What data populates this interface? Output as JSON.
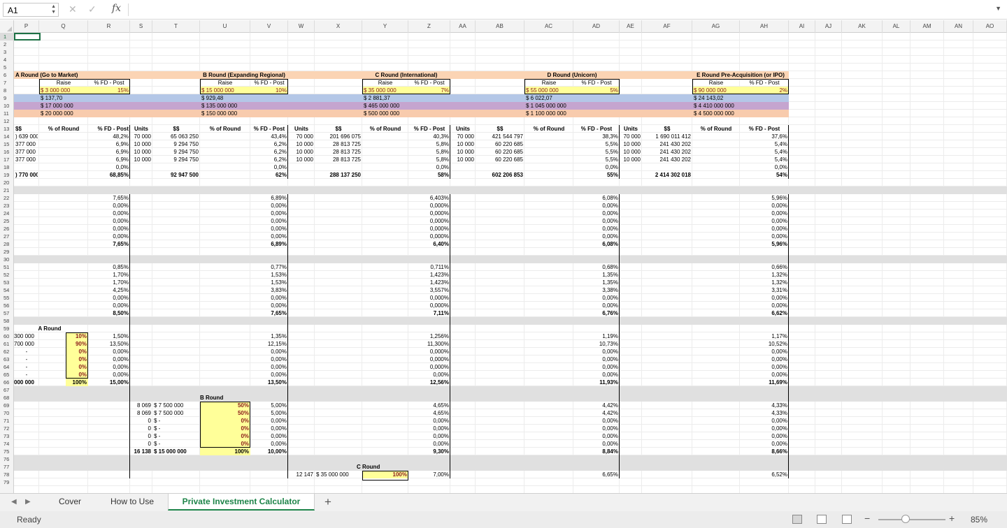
{
  "formula_bar": {
    "name_box": "A1",
    "fx": "fx",
    "formula": ""
  },
  "columns": [
    "P",
    "Q",
    "R",
    "S",
    "T",
    "U",
    "V",
    "W",
    "X",
    "Y",
    "Z",
    "AA",
    "AB",
    "AC",
    "AD",
    "AE",
    "AF",
    "AG",
    "AH",
    "AI",
    "AJ",
    "AK",
    "AL",
    "AM",
    "AN",
    "AO"
  ],
  "rows": [
    "1",
    "2",
    "3",
    "4",
    "5",
    "6",
    "7",
    "8",
    "9",
    "10",
    "11",
    "12",
    "13",
    "14",
    "15",
    "16",
    "17",
    "18",
    "19",
    "20",
    "21",
    "22",
    "23",
    "24",
    "25",
    "26",
    "27",
    "28",
    "29",
    "30",
    "51",
    "52",
    "53",
    "54",
    "55",
    "56",
    "57",
    "58",
    "59",
    "60",
    "61",
    "62",
    "63",
    "64",
    "65",
    "66",
    "67",
    "68",
    "69",
    "70",
    "71",
    "72",
    "73",
    "74",
    "75",
    "76",
    "77",
    "78",
    "79"
  ],
  "rounds": [
    {
      "title": "A Round (Go to Market)",
      "raise_hdr": "Raise",
      "fd_hdr": "% FD - Post",
      "raise": "$  3 000 000",
      "fd": "15%",
      "pps": "$        137,70",
      "pre": "$ 17 000 000",
      "post": "$ 20 000 000"
    },
    {
      "title": "B Round (Expanding Regional)",
      "raise_hdr": "Raise",
      "fd_hdr": "% FD - Post",
      "raise": "$  15 000 000",
      "fd": "10%",
      "pps": "$              929,48",
      "pre": "$ 135 000 000",
      "post": "$ 150 000 000"
    },
    {
      "title": "C Round (International)",
      "raise_hdr": "Raise",
      "fd_hdr": "% FD - Post",
      "raise": "$  35 000 000",
      "fd": "7%",
      "pps": "$      2 881,37",
      "pre": "$ 465 000 000",
      "post": "$ 500 000 000"
    },
    {
      "title": "D Round (Unicorn)",
      "raise_hdr": "Raise",
      "fd_hdr": "% FD - Post",
      "raise": "$     55 000 000",
      "fd": "5%",
      "pps": "$        6 022,07",
      "pre": "$ 1 045 000 000",
      "post": "$ 1 100 000 000"
    },
    {
      "title": "E Round Pre-Acquisition (or IPO)",
      "raise_hdr": "Raise",
      "fd_hdr": "% FD - Post",
      "raise": "$     90 000 000",
      "fd": "2%",
      "pps": "$       24 143,02",
      "pre": "$ 4 410 000 000",
      "post": "$ 4 500 000 000"
    }
  ],
  "table_hdr": {
    "units": "Units",
    "dollars": "$$",
    "pct_round": "% of Round",
    "fd_post": "% FD - Post"
  },
  "q_col": {
    "r13": "$$",
    "r14": ") 639 000",
    "r15": "377 000",
    "r16": "377 000",
    "r17": "377 000",
    "r19": ") 770 000"
  },
  "r_col": {
    "r14": "48,2%",
    "r15": "6,9%",
    "r16": "6,9%",
    "r17": "6,9%",
    "r18": "0,0%",
    "r19": "68,85%"
  },
  "s_col": {
    "r14": "70 000",
    "r15": "10 000",
    "r16": "10 000",
    "r17": "10 000"
  },
  "t_col": {
    "r14": "65 063 250",
    "r15": "9 294 750",
    "r16": "9 294 750",
    "r17": "9 294 750",
    "r19": "92 947 500"
  },
  "v_col": {
    "r14": "43,4%",
    "r15": "6,2%",
    "r16": "6,2%",
    "r17": "6,2%",
    "r18": "0,0%",
    "r19": "62%"
  },
  "w_col": {
    "r14": "70 000",
    "r15": "10 000",
    "r16": "10 000",
    "r17": "10 000"
  },
  "x_col": {
    "r14": "201 696 075",
    "r15": "28 813 725",
    "r16": "28 813 725",
    "r17": "28 813 725",
    "r19": "288 137 250"
  },
  "z_col": {
    "r14": "40,3%",
    "r15": "5,8%",
    "r16": "5,8%",
    "r17": "5,8%",
    "r18": "0,0%",
    "r19": "58%"
  },
  "aa_col": {
    "r14": "70 000",
    "r15": "10 000",
    "r16": "10 000",
    "r17": "10 000"
  },
  "ab_col": {
    "r14": "421 544 797",
    "r15": "60 220 685",
    "r16": "60 220 685",
    "r17": "60 220 685",
    "r19": "602 206 853"
  },
  "ad_col": {
    "r14": "38,3%",
    "r15": "5,5%",
    "r16": "5,5%",
    "r17": "5,5%",
    "r18": "0,0%",
    "r19": "55%"
  },
  "ae_col": {
    "r14": "70 000",
    "r15": "10 000",
    "r16": "10 000",
    "r17": "10 000"
  },
  "af_col": {
    "r14": "1 690 011 412",
    "r15": "241 430 202",
    "r16": "241 430 202",
    "r17": "241 430 202",
    "r19": "2 414 302 018"
  },
  "ah_col": {
    "r14": "37,6%",
    "r15": "5,4%",
    "r16": "5,4%",
    "r17": "5,4%",
    "r18": "0,0%",
    "r19": "54%"
  },
  "blk1": {
    "R": [
      "7,65%",
      "0,00%",
      "0,00%",
      "0,00%",
      "0,00%",
      "0,00%",
      "7,65%"
    ],
    "V": [
      "6,89%",
      "0,00%",
      "0,00%",
      "0,00%",
      "0,00%",
      "0,00%",
      "6,89%"
    ],
    "Z": [
      "6,403%",
      "0,000%",
      "0,000%",
      "0,000%",
      "0,000%",
      "0,000%",
      "6,40%"
    ],
    "AD": [
      "6,08%",
      "0,00%",
      "0,00%",
      "0,00%",
      "0,00%",
      "0,00%",
      "6,08%"
    ],
    "AH": [
      "5,96%",
      "0,00%",
      "0,00%",
      "0,00%",
      "0,00%",
      "0,00%",
      "5,96%"
    ]
  },
  "blk2": {
    "R": [
      "0,85%",
      "1,70%",
      "1,70%",
      "4,25%",
      "0,00%",
      "0,00%",
      "8,50%"
    ],
    "V": [
      "0,77%",
      "1,53%",
      "1,53%",
      "3,83%",
      "0,00%",
      "0,00%",
      "7,65%"
    ],
    "Z": [
      "0,711%",
      "1,423%",
      "1,423%",
      "3,557%",
      "0,000%",
      "0,000%",
      "7,11%"
    ],
    "AD": [
      "0,68%",
      "1,35%",
      "1,35%",
      "3,38%",
      "0,00%",
      "0,00%",
      "6,76%"
    ],
    "AH": [
      "0,66%",
      "1,32%",
      "1,32%",
      "3,31%",
      "0,00%",
      "0,00%",
      "6,62%"
    ]
  },
  "a_round": {
    "label": "A Round",
    "Q": [
      "300 000",
      "700 000",
      "-",
      "-",
      "-",
      "-"
    ],
    "Q_total": "000 000",
    "pct": [
      "10%",
      "90%",
      "0%",
      "0%",
      "0%",
      "0%"
    ],
    "pct_total": "100%",
    "R": [
      "1,50%",
      "13,50%",
      "0,00%",
      "0,00%",
      "0,00%",
      "0,00%",
      "15,00%"
    ],
    "V": [
      "1,35%",
      "12,15%",
      "0,00%",
      "0,00%",
      "0,00%",
      "0,00%",
      "13,50%"
    ],
    "Z": [
      "1,256%",
      "11,300%",
      "0,000%",
      "0,000%",
      "0,000%",
      "0,00%",
      "12,56%"
    ],
    "AD": [
      "1,19%",
      "10,73%",
      "0,00%",
      "0,00%",
      "0,00%",
      "0,00%",
      "11,93%"
    ],
    "AH": [
      "1,17%",
      "10,52%",
      "0,00%",
      "0,00%",
      "0,00%",
      "0,00%",
      "11,69%"
    ]
  },
  "b_round": {
    "label": "B Round",
    "S": [
      "8 069",
      "8 069",
      "0",
      "0",
      "0",
      "0"
    ],
    "S_total": "16 138",
    "T": [
      "$  7 500 000",
      "$  7 500 000",
      "$           -",
      "$           -",
      "$           -",
      "$           -"
    ],
    "T_total": "$ 15 000 000",
    "pct": [
      "50%",
      "50%",
      "0%",
      "0%",
      "0%",
      "0%"
    ],
    "pct_total": "100%",
    "V": [
      "5,00%",
      "5,00%",
      "0,00%",
      "0,00%",
      "0,00%",
      "0,00%",
      "10,00%"
    ],
    "Z": [
      "4,65%",
      "4,65%",
      "0,00%",
      "0,00%",
      "0,00%",
      "0,00%",
      "9,30%"
    ],
    "AD": [
      "4,42%",
      "4,42%",
      "0,00%",
      "0,00%",
      "0,00%",
      "0,00%",
      "8,84%"
    ],
    "AH": [
      "4,33%",
      "4,33%",
      "0,00%",
      "0,00%",
      "0,00%",
      "0,00%",
      "8,66%"
    ]
  },
  "c_round": {
    "label": "C Round",
    "W": "12 147",
    "X": "$ 35 000 000",
    "pct": "100%",
    "Z": "7,00%",
    "AD": "6,65%",
    "AH": "6,52%"
  },
  "tabs": [
    "Cover",
    "How to Use",
    "Private Investment Calculator"
  ],
  "status": {
    "text": "Ready",
    "zoom": "85%"
  }
}
